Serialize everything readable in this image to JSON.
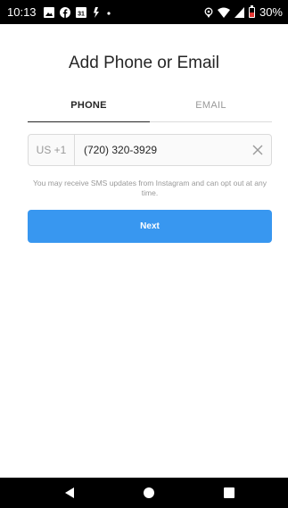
{
  "status_bar": {
    "time": "10:13",
    "battery_percent": "30%",
    "battery_level": 0.3,
    "left_icons": [
      "image-icon",
      "facebook-icon",
      "calendar-icon",
      "wrench-icon",
      "dot-icon"
    ],
    "calendar_day": "31",
    "right_icons": [
      "location-icon",
      "wifi-icon",
      "signal-icon",
      "battery-icon"
    ]
  },
  "page": {
    "title": "Add Phone or Email"
  },
  "tabs": [
    {
      "label": "PHONE",
      "active": true
    },
    {
      "label": "EMAIL",
      "active": false
    }
  ],
  "phone_form": {
    "country_code": "US +1",
    "phone_value": "(720) 320-3929",
    "clear_icon": "close-icon"
  },
  "note": "You may receive SMS updates from Instagram and can opt out at any time.",
  "next_button": {
    "label": "Next",
    "color": "#3897f0"
  },
  "nav_bar": {
    "buttons": [
      "back-icon",
      "home-icon",
      "recents-icon"
    ]
  },
  "colors": {
    "text_primary": "#262626",
    "text_secondary": "#999999",
    "border": "#dbdbdb",
    "accent": "#3897f0",
    "battery_low": "#e53935"
  }
}
